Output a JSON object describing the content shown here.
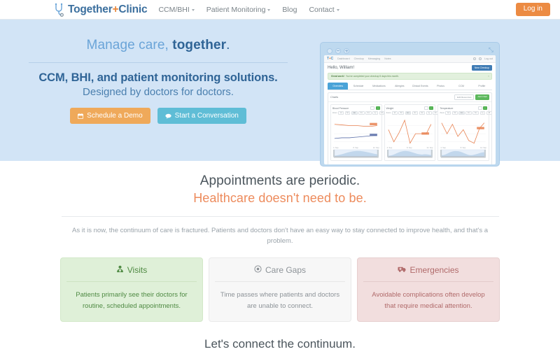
{
  "navbar": {
    "brand": {
      "part1": "Together",
      "plus": "+",
      "part2": "Clinic",
      "icon": "stethoscope-icon"
    },
    "links": [
      {
        "label": "CCM/BHI",
        "caret": true
      },
      {
        "label": "Patient Monitoring",
        "caret": true
      },
      {
        "label": "Blog",
        "caret": false
      },
      {
        "label": "Contact",
        "caret": true
      }
    ],
    "login_label": "Log in",
    "login_color": "#ec8b43"
  },
  "hero": {
    "tagline_light": "Manage care, ",
    "tagline_bold": "together",
    "tagline_period": ".",
    "headline": "CCM, BHI, and patient monitoring solutions.",
    "subheadline": "Designed by doctors for doctors.",
    "buttons": [
      {
        "label": "Schedule a Demo",
        "icon": "calendar-icon",
        "color": "#efa95a"
      },
      {
        "label": "Start a Conversation",
        "icon": "chat-icon",
        "color": "#5fbdd6"
      }
    ],
    "background_color": "#d2e4f6"
  },
  "mockup": {
    "window_controls": [
      "circle-dot-icon",
      "circle-minus-icon",
      "circle-plus-icon"
    ],
    "expand_icon": "expand-arrows-icon",
    "app_logo": {
      "part1": "T",
      "plus": "+",
      "part2": "C"
    },
    "app_nav": [
      "Dashboard",
      "Checkup",
      "Messaging",
      "Notes"
    ],
    "app_nav_right": [
      "gear-icon",
      "bell-icon",
      "Log out"
    ],
    "greeting": "Hello, William!",
    "new_checkup_label": "New Checkup",
    "alert_bold": "Great work!",
    "alert_text": "You've completed your checkup 5 days this month.",
    "tabs": [
      "Overview",
      "Schedule",
      "Medications",
      "Allergies",
      "Clinical Events",
      "Photos",
      "CCM",
      "Profile"
    ],
    "active_tab": "Overview",
    "panel_title": "Charts",
    "panel_buttons": [
      {
        "label": "Edit Resources",
        "style": "grey"
      },
      {
        "label": "Add Chart",
        "style": "green"
      }
    ],
    "zoom_chips": [
      "Zoom",
      "1d",
      "5d",
      "1m",
      "3m",
      "6m",
      "1y",
      "All"
    ],
    "active_zoom": "1m",
    "charts": [
      {
        "name": "Blood Pressure",
        "axis_start": "4. Sep",
        "axis_mid": "8. Sep",
        "axis_end": "12. Sep"
      },
      {
        "name": "Weight",
        "axis_start": "4. Sep",
        "axis_mid": "8. Sep",
        "axis_end": "12. Sep"
      },
      {
        "name": "Temperature",
        "axis_start": "4. Sep",
        "axis_mid": "8. Sep",
        "axis_end": "12. Sep"
      }
    ]
  },
  "mid": {
    "headline": "Appointments are periodic.",
    "subheadline": "Healthcare doesn't need to be.",
    "paragraph": "As it is now, the continuum of care is fractured. Patients and doctors don't have an easy way to stay connected to improve health, and that's a problem."
  },
  "cards": [
    {
      "title": "Visits",
      "icon": "doctor-icon",
      "body": "Patients primarily see their doctors for routine, scheduled appointments.",
      "theme": "green",
      "color": "#4f8a43"
    },
    {
      "title": "Care Gaps",
      "icon": "dot-circle-icon",
      "body": "Time passes where patients and doctors are unable to connect.",
      "theme": "grey",
      "color": "#8d9398"
    },
    {
      "title": "Emergencies",
      "icon": "ambulance-icon",
      "body": "Avoidable complications often develop that require medical attention.",
      "theme": "red",
      "color": "#b06a6a"
    }
  ],
  "closing": "Let's connect the continuum."
}
